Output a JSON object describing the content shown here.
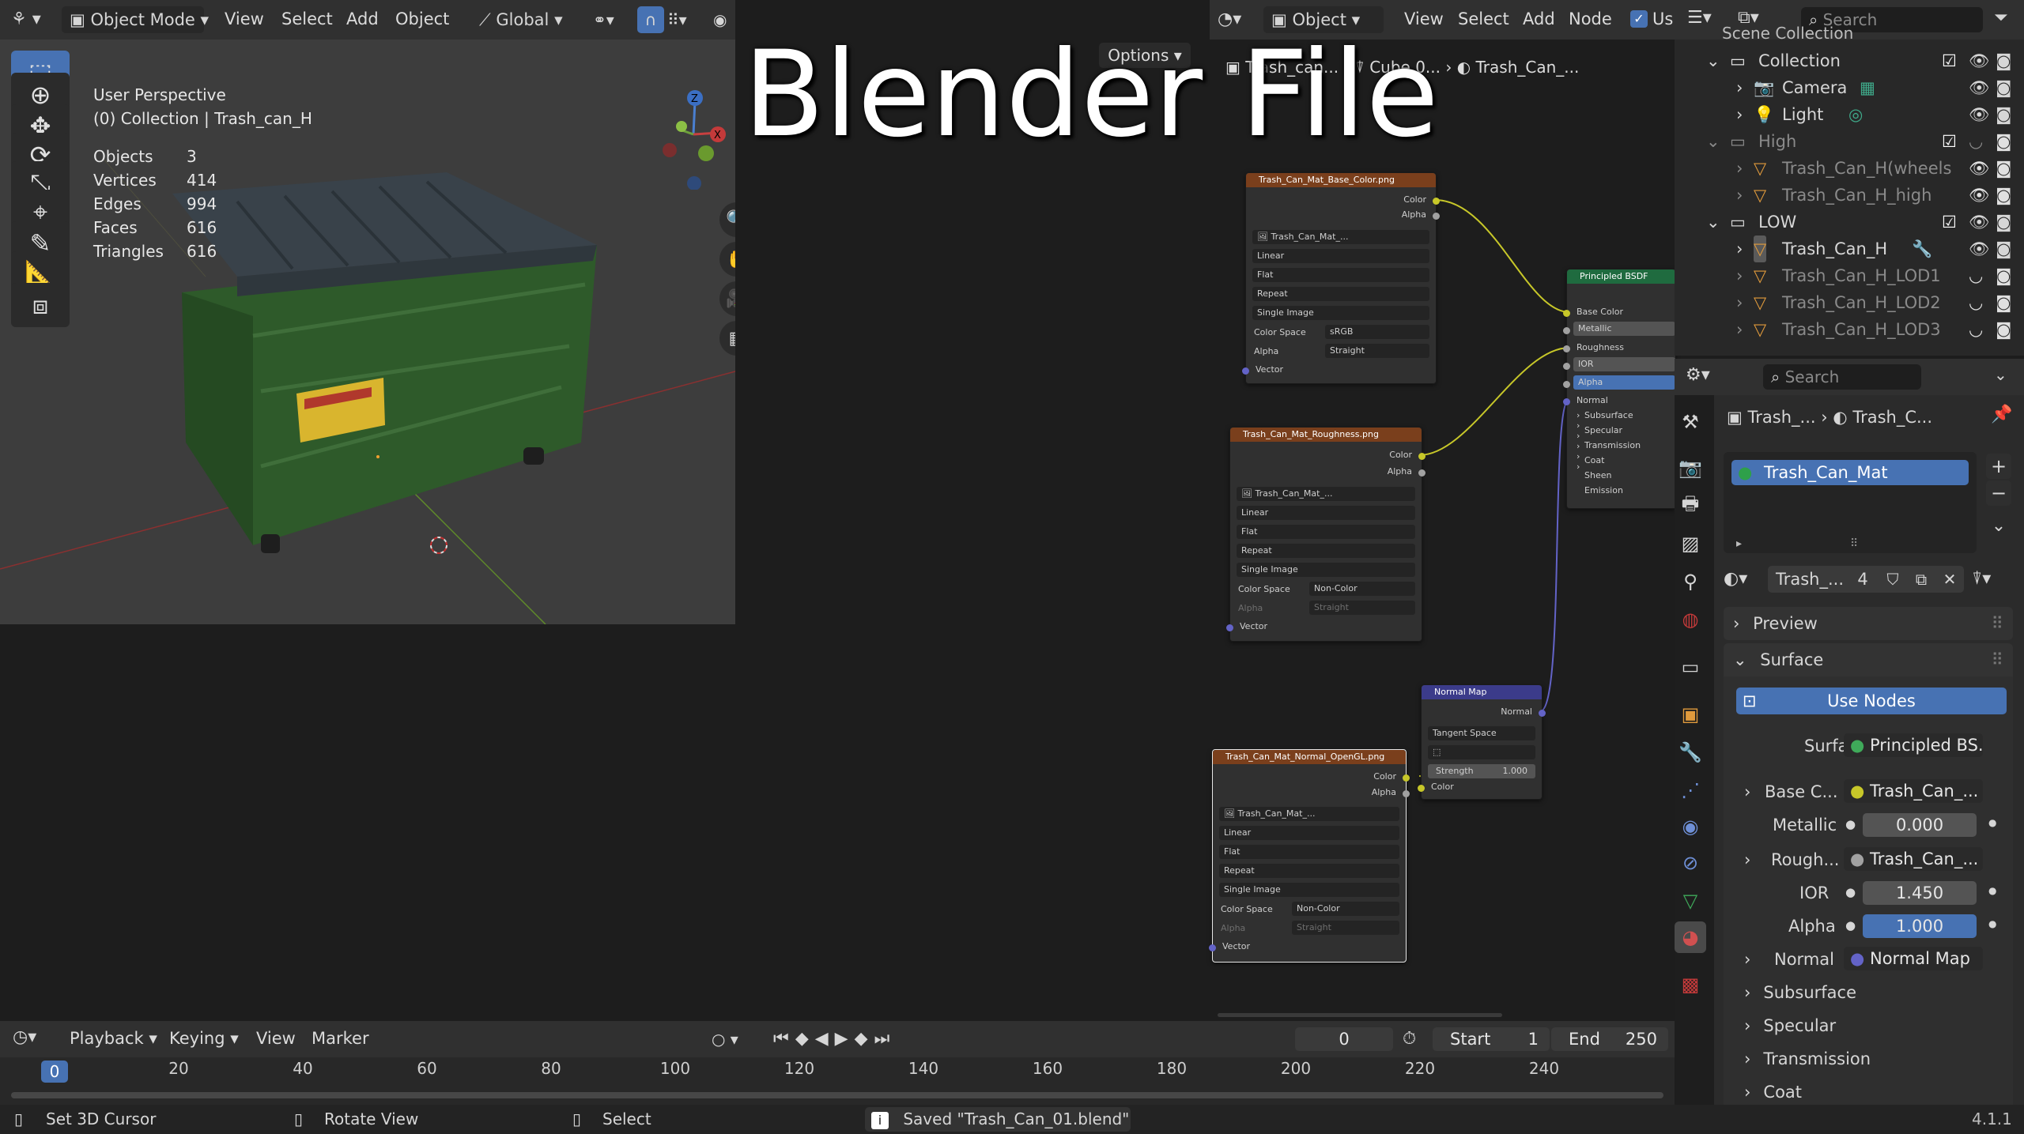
{
  "overlay_title": "Blender File",
  "viewport_header": {
    "mode": "Object Mode",
    "menus": [
      "View",
      "Select",
      "Add",
      "Object"
    ],
    "orientation": "Global",
    "options_label": "Options"
  },
  "viewport_info": {
    "perspective": "User Perspective",
    "collection": "(0) Collection | Trash_can_H",
    "stats": [
      {
        "label": "Objects",
        "value": "3"
      },
      {
        "label": "Vertices",
        "value": "414"
      },
      {
        "label": "Edges",
        "value": "994"
      },
      {
        "label": "Faces",
        "value": "616"
      },
      {
        "label": "Triangles",
        "value": "616"
      }
    ]
  },
  "gizmo_axes": {
    "x": "X",
    "y": "Y",
    "z": "Z"
  },
  "node_header": {
    "editor_type": "Object",
    "menus": [
      "View",
      "Select",
      "Add",
      "Node"
    ],
    "use_label": "Us"
  },
  "node_breadcrumb": [
    "Trash_can...",
    "Cube.0...",
    "Trash_Can_..."
  ],
  "nodes": {
    "base_color": {
      "title": "Trash_Can_Mat_Base_Color.png",
      "out_color": "Color",
      "out_alpha": "Alpha",
      "image": "Trash_Can_Mat_...",
      "interpolation": "Linear",
      "projection": "Flat",
      "extension": "Repeat",
      "source": "Single Image",
      "colorspace_label": "Color Space",
      "colorspace": "sRGB",
      "alpha_label": "Alpha",
      "alpha": "Straight",
      "vector": "Vector"
    },
    "roughness": {
      "title": "Trash_Can_Mat_Roughness.png",
      "out_color": "Color",
      "out_alpha": "Alpha",
      "image": "Trash_Can_Mat_...",
      "interpolation": "Linear",
      "projection": "Flat",
      "extension": "Repeat",
      "source": "Single Image",
      "colorspace_label": "Color Space",
      "colorspace": "Non-Color",
      "alpha_label": "Alpha",
      "alpha": "Straight",
      "vector": "Vector"
    },
    "normal_img": {
      "title": "Trash_Can_Mat_Normal_OpenGL.png",
      "out_color": "Color",
      "out_alpha": "Alpha",
      "image": "Trash_Can_Mat_...",
      "interpolation": "Linear",
      "projection": "Flat",
      "extension": "Repeat",
      "source": "Single Image",
      "colorspace_label": "Color Space",
      "colorspace": "Non-Color",
      "alpha_label": "Alpha",
      "alpha": "Straight",
      "vector": "Vector"
    },
    "normal_map": {
      "title": "Normal Map",
      "out_normal": "Normal",
      "space": "Tangent Space",
      "strength_label": "Strength",
      "strength": "1.000",
      "in_color": "Color"
    },
    "bsdf": {
      "title": "Principled BSDF",
      "base_color": "Base Color",
      "metallic": "Metallic",
      "roughness": "Roughness",
      "ior": "IOR",
      "alpha": "Alpha",
      "normal": "Normal",
      "sections": [
        "Subsurface",
        "Specular",
        "Transmission",
        "Coat",
        "Sheen",
        "Emission"
      ]
    }
  },
  "outliner": {
    "search_placeholder": "Search",
    "root": "Scene Collection",
    "rows": [
      {
        "label": "Collection",
        "type": "collection"
      },
      {
        "label": "Camera",
        "type": "camera"
      },
      {
        "label": "Light",
        "type": "light"
      },
      {
        "label": "High",
        "type": "collection"
      },
      {
        "label": "Trash_Can_H(wheels",
        "type": "mesh"
      },
      {
        "label": "Trash_Can_H_high",
        "type": "mesh"
      },
      {
        "label": "LOW",
        "type": "collection"
      },
      {
        "label": "Trash_Can_H",
        "type": "mesh"
      },
      {
        "label": "Trash_Can_H_LOD1",
        "type": "mesh"
      },
      {
        "label": "Trash_Can_H_LOD2",
        "type": "mesh"
      },
      {
        "label": "Trash_Can_H_LOD3",
        "type": "mesh"
      }
    ]
  },
  "properties": {
    "search_placeholder": "Search",
    "breadcrumb_object": "Trash_...",
    "breadcrumb_material": "Trash_C...",
    "material_slot": "Trash_Can_Mat",
    "material_name": "Trash_...",
    "user_count": "4",
    "panel_preview": "Preview",
    "panel_surface": "Surface",
    "use_nodes": "Use Nodes",
    "rows": [
      {
        "label": "Surface",
        "value": "Principled BS..."
      },
      {
        "label": "Base C...",
        "value": "Trash_Can_..."
      },
      {
        "label": "Metallic",
        "value": "0.000"
      },
      {
        "label": "Rough...",
        "value": "Trash_Can_..."
      },
      {
        "label": "IOR",
        "value": "1.450"
      },
      {
        "label": "Alpha",
        "value": "1.000"
      },
      {
        "label": "Normal",
        "value": "Normal Map"
      }
    ],
    "subpanels": [
      "Subsurface",
      "Specular",
      "Transmission",
      "Coat"
    ]
  },
  "timeline": {
    "menus": [
      "Playback",
      "Keying",
      "View",
      "Marker"
    ],
    "current_frame": "0",
    "start_label": "Start",
    "start": "1",
    "end_label": "End",
    "end": "250",
    "ruler": [
      "0",
      "20",
      "40",
      "60",
      "80",
      "100",
      "120",
      "140",
      "160",
      "180",
      "200",
      "220",
      "240"
    ]
  },
  "statusbar": {
    "set_cursor": "Set 3D Cursor",
    "rotate": "Rotate View",
    "select": "Select",
    "message": "Saved \"Trash_Can_01.blend\"",
    "version": "4.1.1"
  },
  "colors": {
    "accent": "#4772b3",
    "header": "#303030",
    "viewport_bg": "#3d3d3d",
    "node_editor_bg": "#1d1d1d",
    "texture_node_header": "#7a3f1c",
    "shader_node_header": "#1f6b3f",
    "vector_node_header": "#3b3b8a",
    "dumpster_green": "#2e5a2a"
  }
}
